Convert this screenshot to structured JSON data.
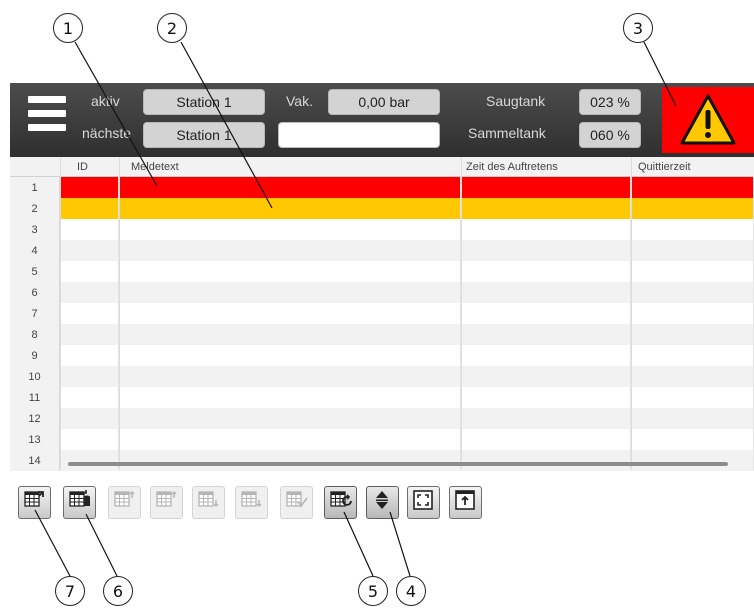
{
  "callouts": [
    "1",
    "2",
    "3",
    "4",
    "5",
    "6",
    "7"
  ],
  "header": {
    "active_label": "aktiv",
    "active_value": "Station 1",
    "next_label": "nächste",
    "next_value": "Station 1",
    "vac_label": "Vak.",
    "vac_value": "0,00 bar",
    "vac_extra_value": "",
    "suction_tank_label": "Saugtank",
    "suction_tank_value": "023 %",
    "collection_tank_label": "Sammeltank",
    "collection_tank_value": "060 %"
  },
  "table": {
    "columns": [
      "ID",
      "Meldetext",
      "Zeit des Auftretens",
      "Quittierzeit"
    ],
    "row_numbers": [
      "1",
      "2",
      "3",
      "4",
      "5",
      "6",
      "7",
      "8",
      "9",
      "10",
      "11",
      "12",
      "13",
      "14"
    ],
    "row_states": [
      "alarm",
      "warning",
      "none",
      "none",
      "none",
      "none",
      "none",
      "none",
      "none",
      "none",
      "none",
      "none",
      "none",
      "none"
    ]
  },
  "colors": {
    "alarm_red": "#ff0000",
    "warning_yellow": "#ffc800",
    "header_bg": "#3a3a3a",
    "warning_sign_fill": "#ffc800"
  },
  "toolbar": {
    "buttons": [
      {
        "icon": "table-export-icon",
        "enabled": true
      },
      {
        "icon": "table-database-icon",
        "enabled": true
      },
      {
        "icon": "table-sort-up-icon",
        "enabled": false
      },
      {
        "icon": "table-move-up-icon",
        "enabled": false
      },
      {
        "icon": "table-move-down-icon",
        "enabled": false
      },
      {
        "icon": "table-sort-down-icon",
        "enabled": false
      },
      {
        "icon": "table-check-icon",
        "enabled": false
      },
      {
        "icon": "table-refresh-icon",
        "enabled": true
      },
      {
        "icon": "sort-updown-icon",
        "enabled": true
      },
      {
        "icon": "window-fit-icon",
        "enabled": true
      },
      {
        "icon": "window-restore-icon",
        "enabled": true
      }
    ]
  }
}
